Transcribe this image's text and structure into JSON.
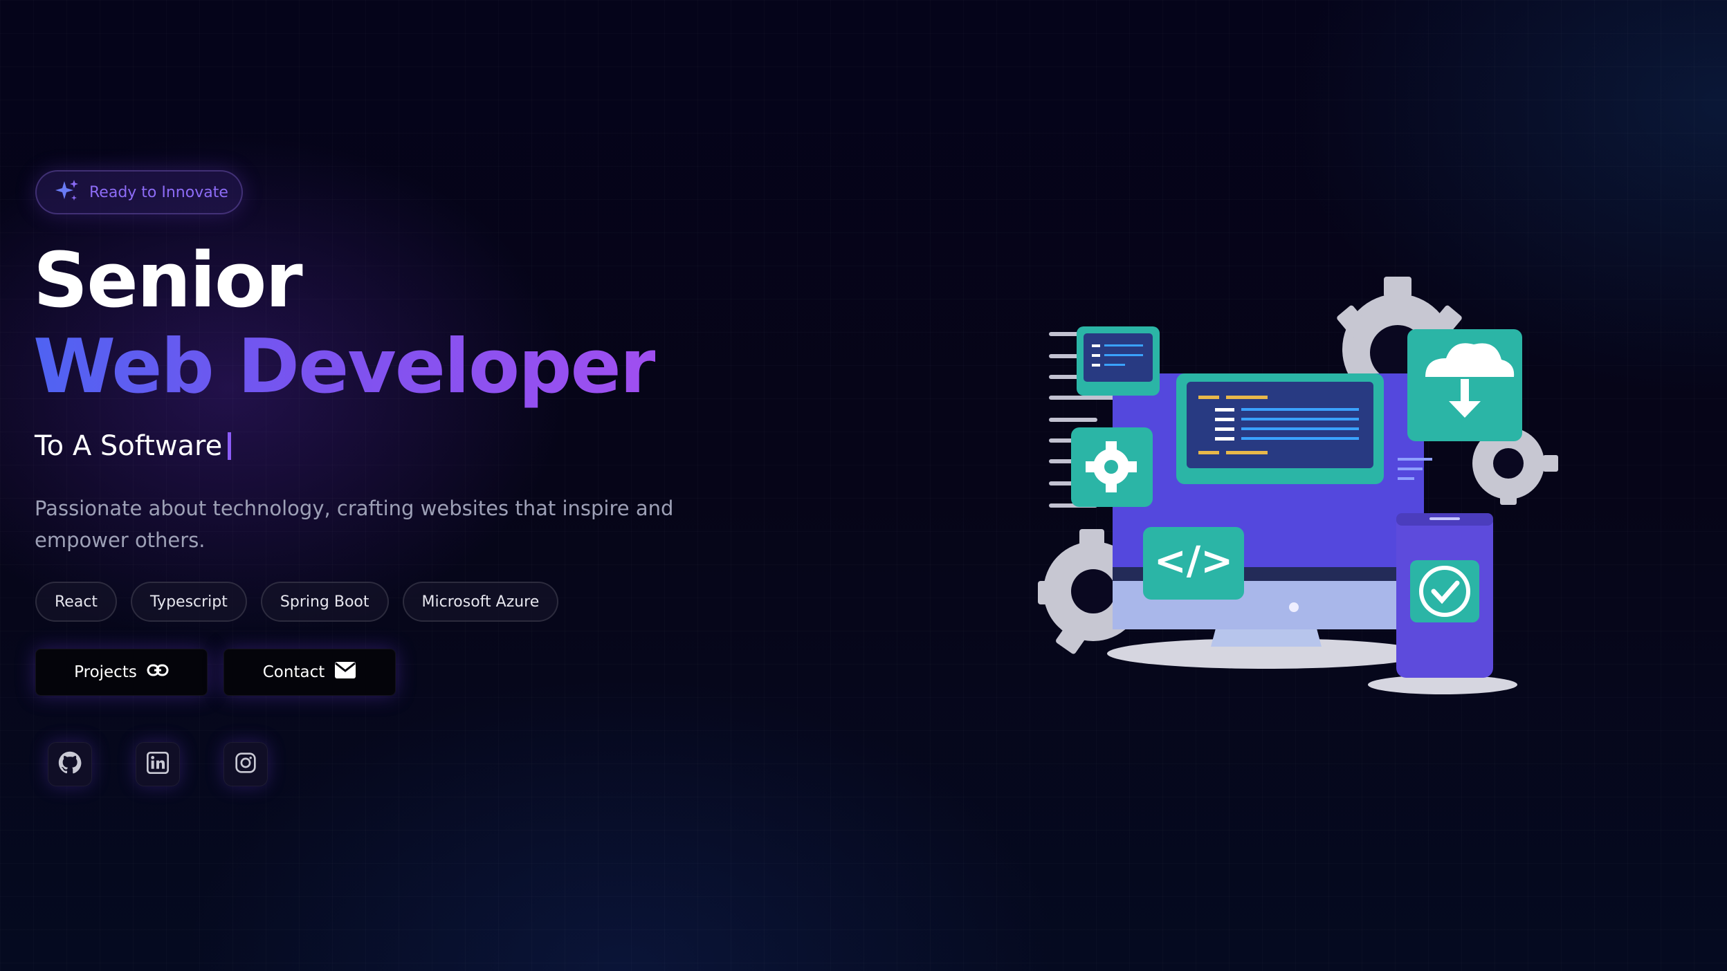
{
  "hero": {
    "badge": "Ready to Innovate",
    "title_line1": "Senior",
    "title_line2": "Web Developer",
    "typing_text": "To A Software",
    "description": "Passionate about technology, crafting websites that inspire and empower others.",
    "tags": [
      "React",
      "Typescript",
      "Spring Boot",
      "Microsoft Azure"
    ],
    "buttons": {
      "projects_label": "Projects",
      "contact_label": "Contact"
    }
  },
  "socials": [
    {
      "icon": "github-icon"
    },
    {
      "icon": "linkedin-icon"
    },
    {
      "icon": "instagram-icon"
    }
  ],
  "colors": {
    "background": "#04030f",
    "accent_purple": "#8b5cf6",
    "accent_blue": "#4f63f2",
    "teal": "#2bb5a6"
  }
}
